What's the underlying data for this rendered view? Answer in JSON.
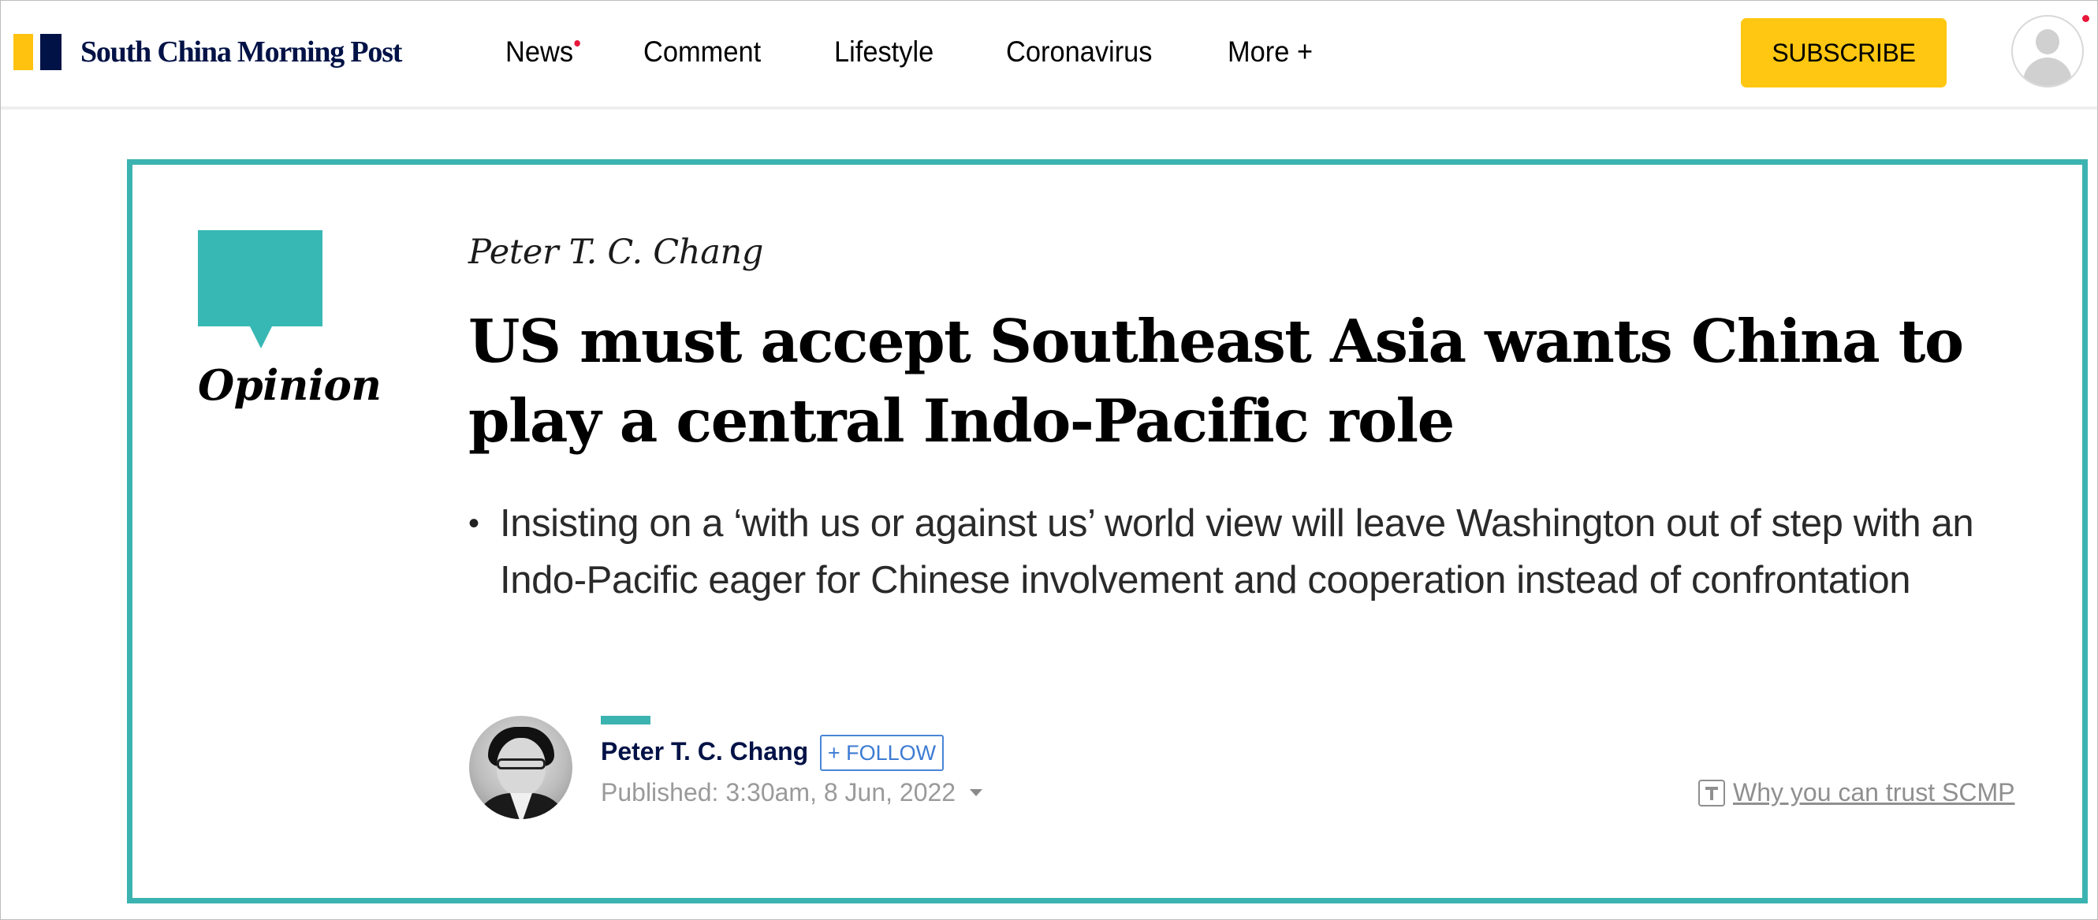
{
  "header": {
    "logo_text": "South China Morning Post",
    "nav": [
      {
        "label": "News",
        "has_dot": true
      },
      {
        "label": "Comment"
      },
      {
        "label": "Lifestyle"
      },
      {
        "label": "Coronavirus"
      },
      {
        "label": "More +"
      }
    ],
    "subscribe_label": "SUBSCRIBE",
    "account_icon": "user-avatar-icon"
  },
  "article": {
    "section_label": "Opinion",
    "section_icon": "speech-bubble-icon",
    "byline_top": "Peter T. C. Chang",
    "headline": "US must accept Southeast Asia wants China to play a central Indo-Pacific role",
    "summary_bullet": "•",
    "summary": "Insisting on a ‘with us or against us’ world view will leave Washington out of step with an Indo-Pacific eager for Chinese involvement and cooperation instead of confrontation",
    "author": {
      "name": "Peter T. C. Chang",
      "follow_label": "+ FOLLOW"
    },
    "published": "Published: 3:30am, 8 Jun, 2022",
    "trust_link": "Why you can trust SCMP",
    "trust_icon": "t-box-icon"
  },
  "colors": {
    "brand_yellow": "#ffc20e",
    "brand_navy": "#001246",
    "opinion_teal": "#3bb3b1",
    "subscribe_yellow": "#ffc711",
    "follow_blue": "#3c7bd3",
    "notification_red": "#e8173a"
  }
}
